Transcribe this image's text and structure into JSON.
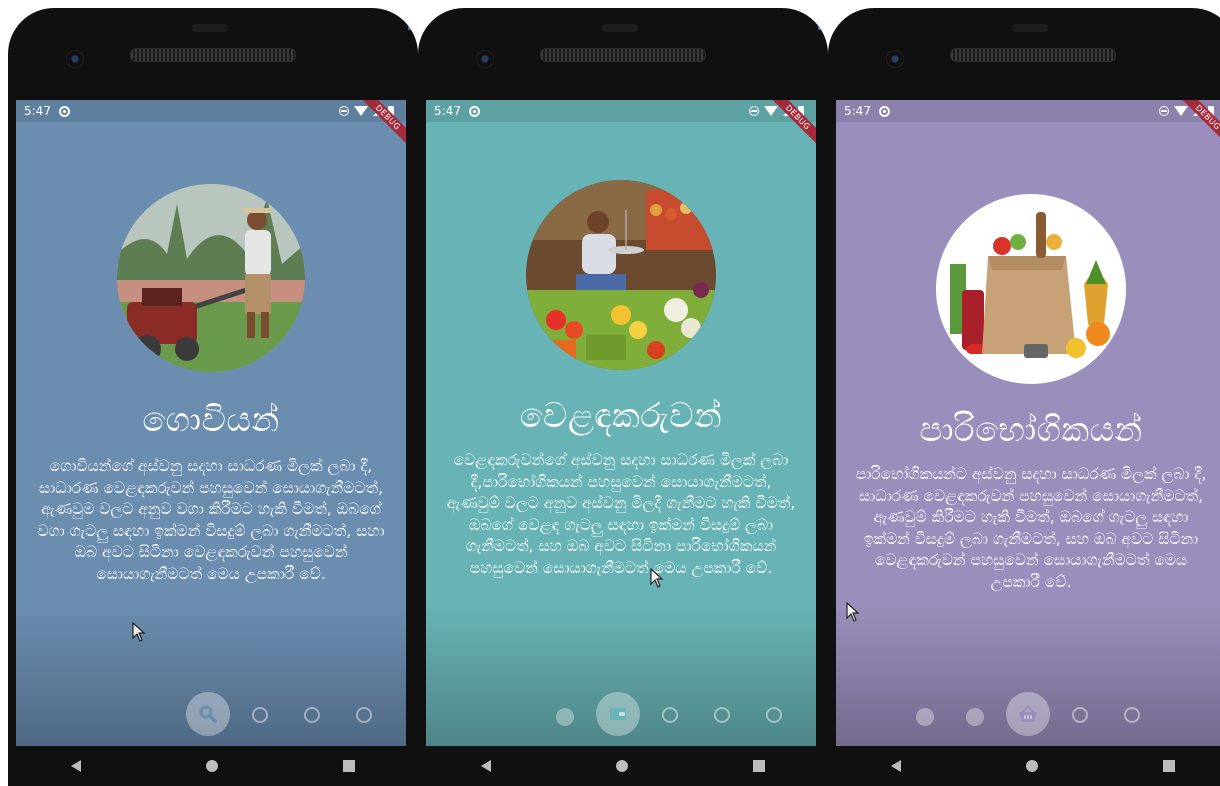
{
  "status_time": "5:47",
  "debug_label": "DEBUG",
  "colors": {
    "farmer_bg": "#6b8db0",
    "trader_bg": "#68b3b5",
    "consumer_bg": "#9a8ebc"
  },
  "screens": [
    {
      "title": "ගොවියන්",
      "description": "ගොවියන්ගේ අස්වනු සදහා සාධරණ මිලක් ලබා දී, සාධාරණ වෙළඳකරුවන් පහසුවෙන් සොයාගැනීමටත්, ඇණවුම වලට අනුව වගා කිරීමට හැකි වීමත්, ඔබගේ වගා ගැටලු සඳහා ඉක්මන් විසදුම් ලබා ගැනීමටත්, සහා ඔබ අවට සිටිනා වෙළඳකරුවන් පහසුවෙන් සොයාගැනීමටත් මෙය උපකාරී වේ.",
      "active_icon": "search-icon",
      "hero_icon": "farmer-tilling-photo"
    },
    {
      "title": "වෙළඳකරුවන්",
      "description": "වෙළඳකරුවන්ගේ අස්වනු සදහා සාධරණ මිලක් ලබා දී,පාරිභෝගිකයන් පහසුවෙන් සොයාගැනීමටත්, ඇණවුම් වලට අනුව අස්වනු මිලදී ගැනීමට හැකි වීමත්, ඔබගේ වෙළඳ ගැටලු සඳහා ඉක්මන් විසදුම් ලබා ගැනීමටත්, සහ ඔබ අවට සිටිනා පාරිභෝගිකයන් පහසුවෙන් සොයාගැනීමටත් මෙය උපකාරී වේ.",
      "active_icon": "wallet-icon",
      "hero_icon": "vegetable-vendor-photo"
    },
    {
      "title": "පාරිභෝගිකයන්",
      "description": "පාරිභෝගිකයන්ට අස්වනු සදහා සාධරණ මිලක් ලබා දී, සාධාරණ වෙළඳකරුවන් පහසුවෙන් සොයාගැනීමටත්, ඇණවුම් කිරීමට හැකි වීමත්, ඔබගේ ගැටලු සඳහා ඉක්මන් විසදුම් ලබා ගැනීමටත්, සහ ඔබ අවට සිටිනා වෙළඳකරුවන් පහසුවෙන් සොයාගැනීමටත් මෙය උපකාරී වේ.",
      "active_icon": "basket-icon",
      "hero_icon": "grocery-bag-photo"
    }
  ],
  "page_indicator": {
    "total_pages": 5,
    "active_pages": [
      1,
      2,
      3
    ]
  }
}
